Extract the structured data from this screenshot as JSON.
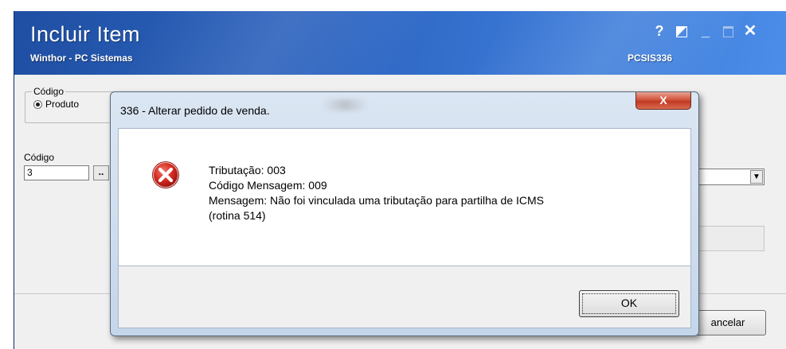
{
  "window": {
    "title": "Incluir Item",
    "subtitle": "Winthor - PC Sistemas",
    "code": "PCSIS336",
    "buttons": {
      "help": "?",
      "minimize": "_",
      "close": "✕"
    }
  },
  "form": {
    "group_label": "Código",
    "radio_label": "Produto",
    "codigo_label": "Código",
    "codigo_value": "3",
    "lookup_label": "..",
    "total_label": "Total",
    "total_label_visible": "otal",
    "cancel_label": "Cancelar",
    "cancel_label_visible": "ancelar"
  },
  "dialog": {
    "title": "336 - Alterar pedido de venda.",
    "close_label": "X",
    "lines": [
      "Tributação: 003",
      "Código Mensagem: 009",
      "Mensagem: Não foi vinculada uma tributação para partilha de ICMS",
      "(rotina 514)"
    ],
    "ok_label": "OK",
    "icon": "error-icon"
  },
  "colors": {
    "titlebar": "#2d64c0",
    "dialog_frame": "#c4d6ea",
    "close_red": "#c23a22",
    "error_red": "#c81e1e"
  }
}
